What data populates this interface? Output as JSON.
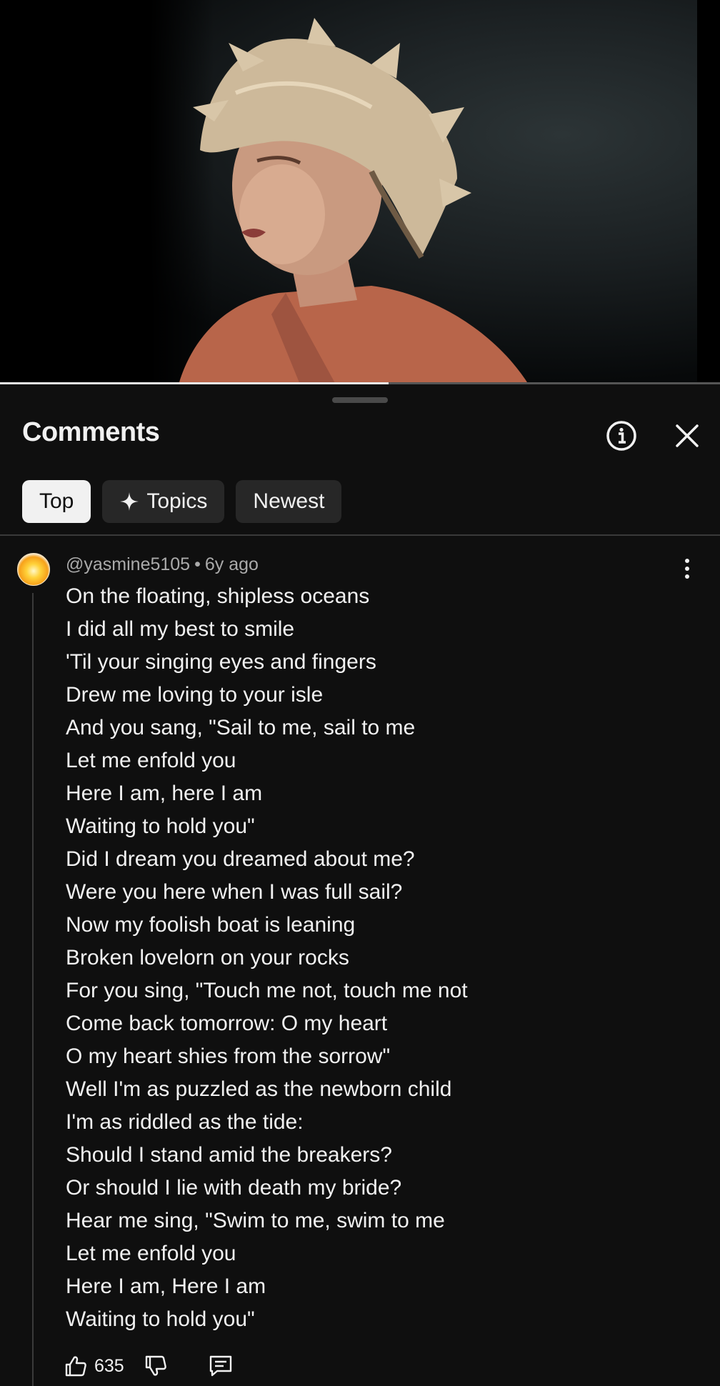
{
  "video": {
    "progress_fraction": 0.54
  },
  "comments_panel": {
    "title": "Comments",
    "info_icon": "info-icon",
    "close_icon": "close-icon",
    "chips": [
      {
        "label": "Top",
        "active": true
      },
      {
        "label": "Topics",
        "icon": "sparkle-icon",
        "active": false
      },
      {
        "label": "Newest",
        "active": false
      }
    ]
  },
  "comment": {
    "author": "@yasmine5105",
    "separator": "•",
    "time": "6y ago",
    "lines": [
      "On the floating, shipless oceans",
      "I did all my best to smile",
      "'Til your singing eyes and fingers",
      "Drew me loving to your isle",
      "And you sang, \"Sail to me, sail to me",
      "Let me enfold you",
      "Here I am, here I am",
      "Waiting to hold you\"",
      "Did I dream you dreamed about me?",
      "Were you here when I was full sail?",
      "Now my foolish boat is leaning",
      "Broken lovelorn on your rocks",
      "For you sing, \"Touch me not, touch me not",
      "Come back tomorrow: O my heart",
      "O my heart shies from the sorrow\"",
      "Well I'm as puzzled as the newborn child",
      "I'm as riddled as the tide:",
      "Should I stand amid the breakers?",
      "Or should I lie with death my bride?",
      "Hear me sing, \"Swim to me, swim to me",
      "Let me enfold you",
      "Here I am, Here I am",
      "Waiting to hold you\""
    ],
    "likes": "635"
  }
}
